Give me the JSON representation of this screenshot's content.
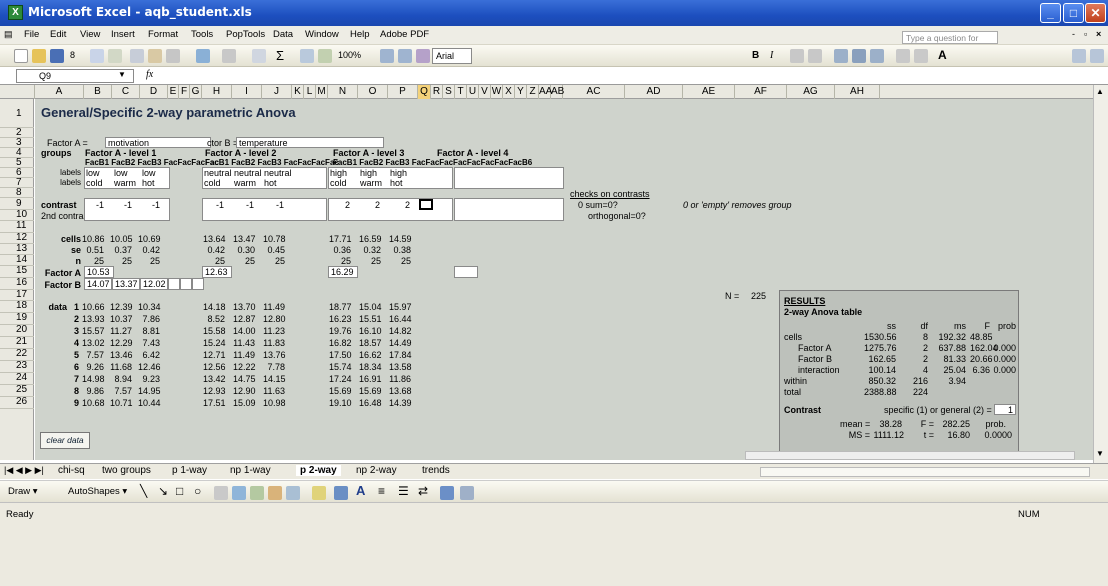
{
  "window": {
    "title": "Microsoft Excel - aqb_student.xls",
    "minimize": "_",
    "maximize": "□",
    "close": "✕"
  },
  "menu": [
    "File",
    "Edit",
    "View",
    "Insert",
    "Format",
    "Tools",
    "PopTools",
    "Data",
    "Window",
    "Help",
    "Adobe PDF"
  ],
  "help_placeholder": "Type a question for help",
  "toolbar": {
    "font_size": "8",
    "zoom": "100%",
    "font": "Arial",
    "bold": "B",
    "italic": "I"
  },
  "formula": {
    "namebox": "Q9",
    "fx": "fx"
  },
  "columns": [
    "A",
    "B",
    "C",
    "D",
    "E",
    "F",
    "G",
    "H",
    "I",
    "J",
    "K",
    "L",
    "M",
    "N",
    "O",
    "P",
    "Q",
    "R",
    "S",
    "T",
    "U",
    "V",
    "W",
    "X",
    "Y",
    "Z",
    "AA",
    "AB",
    "AC",
    "AD",
    "AE",
    "AF",
    "AG",
    "AH"
  ],
  "rows": [
    "1",
    "2",
    "3",
    "4",
    "5",
    "6",
    "7",
    "8",
    "9",
    "10",
    "11",
    "12",
    "13",
    "14",
    "15",
    "16",
    "17",
    "18",
    "19",
    "20",
    "21",
    "22",
    "23",
    "24",
    "25",
    "26"
  ],
  "sheet": {
    "title": "General/Specific 2-way parametric Anova",
    "factor_a_label": "Factor A =",
    "factor_a_value": "motivation",
    "factor_b_label": "ctor B =",
    "factor_b_value": "temperature",
    "groups": "groups",
    "levels": [
      "Factor A - level 1",
      "Factor A - level 2",
      "Factor A - level 3",
      "Factor A - level 4"
    ],
    "facb": "FacB1  FacB2  FacB3  FacFacFacFac",
    "facb_last": "FacB1  FacB2  FacB3  FacFacFacFacFacFacFacFacB6",
    "labels": "labels",
    "lab1": [
      [
        "low",
        "low",
        "low"
      ],
      [
        "neutral",
        "neutral",
        "neutral"
      ],
      [
        "high",
        "high",
        "high"
      ]
    ],
    "lab2": [
      [
        "cold",
        "warm",
        "hot"
      ],
      [
        "cold",
        "warm",
        "hot"
      ],
      [
        "cold",
        "warm",
        "hot"
      ]
    ],
    "checks_title": "checks on contrasts",
    "sum0": "0  sum=0?",
    "orth": "orthogonal=0?",
    "empty_note": "0 or 'empty' removes group",
    "contrast": "contrast",
    "contrast2": "2nd contrast",
    "contrast_vals": [
      [
        "-1",
        "-1",
        "-1"
      ],
      [
        "-1",
        "-1",
        "-1"
      ],
      [
        "2",
        "2",
        "2"
      ]
    ],
    "cells_lbl": "cells",
    "se_lbl": "se",
    "n_lbl": "n",
    "cells": [
      [
        "10.86",
        "10.05",
        "10.69"
      ],
      [
        "13.64",
        "13.47",
        "10.78"
      ],
      [
        "17.71",
        "16.59",
        "14.59"
      ]
    ],
    "se": [
      [
        "0.51",
        "0.37",
        "0.42"
      ],
      [
        "0.42",
        "0.30",
        "0.45"
      ],
      [
        "0.36",
        "0.32",
        "0.38"
      ]
    ],
    "n": [
      [
        "25",
        "25",
        "25"
      ],
      [
        "25",
        "25",
        "25"
      ],
      [
        "25",
        "25",
        "25"
      ]
    ],
    "factor_a": "Factor A",
    "factor_b": "Factor B",
    "fa_vals": [
      "10.53",
      "12.63",
      "16.29"
    ],
    "fb_vals": [
      "14.07",
      "13.37",
      "12.02"
    ],
    "n_total_lbl": "N =",
    "n_total": "225",
    "data_lbl": "data",
    "data_idx": [
      "1",
      "2",
      "3",
      "4",
      "5",
      "6",
      "7",
      "8",
      "9"
    ],
    "data": [
      [
        "10.66",
        "12.39",
        "10.34",
        "14.18",
        "13.70",
        "11.49",
        "18.77",
        "15.04",
        "15.97"
      ],
      [
        "13.93",
        "10.37",
        "7.86",
        "8.52",
        "12.87",
        "12.80",
        "16.23",
        "15.51",
        "16.44"
      ],
      [
        "15.57",
        "11.27",
        "8.81",
        "15.58",
        "14.00",
        "11.23",
        "19.76",
        "16.10",
        "14.82"
      ],
      [
        "13.02",
        "12.29",
        "7.43",
        "15.24",
        "11.43",
        "11.83",
        "16.82",
        "18.57",
        "14.49"
      ],
      [
        "7.57",
        "13.46",
        "6.42",
        "12.71",
        "11.49",
        "13.76",
        "17.50",
        "16.62",
        "17.84"
      ],
      [
        "9.26",
        "11.68",
        "12.46",
        "12.56",
        "12.22",
        "7.78",
        "15.74",
        "18.34",
        "13.58"
      ],
      [
        "14.98",
        "8.94",
        "9.23",
        "13.42",
        "14.75",
        "14.15",
        "17.24",
        "16.91",
        "11.86"
      ],
      [
        "9.86",
        "7.57",
        "14.95",
        "12.93",
        "12.90",
        "11.63",
        "15.69",
        "15.69",
        "13.68"
      ],
      [
        "10.68",
        "10.71",
        "10.44",
        "17.51",
        "15.09",
        "10.98",
        "19.10",
        "16.48",
        "14.39"
      ]
    ],
    "clear_data": "clear data"
  },
  "results": {
    "title": "RESULTS",
    "subtitle": "2-way Anova table",
    "headers": [
      "ss",
      "df",
      "ms",
      "F",
      "prob"
    ],
    "rows": [
      [
        "cells",
        "1530.56",
        "8",
        "192.32",
        "48.85",
        ""
      ],
      [
        "Factor A",
        "1275.76",
        "2",
        "637.88",
        "162.04",
        "0.000"
      ],
      [
        "Factor B",
        "162.65",
        "2",
        "81.33",
        "20.66",
        "0.000"
      ],
      [
        "interaction",
        "100.14",
        "4",
        "25.04",
        "6.36",
        "0.000"
      ],
      [
        "within",
        "850.32",
        "216",
        "3.94",
        "",
        ""
      ],
      [
        "total",
        "2388.88",
        "224",
        "",
        "",
        ""
      ]
    ],
    "contrast_lbl": "Contrast",
    "spec_lbl": "specific (1) or general (2) =",
    "spec_val": "1",
    "mean_lbl": "mean =",
    "mean_val": "38.28",
    "f_lbl": "F =",
    "f_val": "282.25",
    "prob_lbl": "prob.",
    "ms_lbl": "MS =",
    "ms_val": "1111.12",
    "t_lbl": "t =",
    "t_val": "16.80",
    "p_val": "0.0000"
  },
  "tabs": [
    "chi-sq",
    "two groups",
    "p 1-way",
    "np 1-way",
    "p 2-way",
    "np 2-way",
    "trends"
  ],
  "active_tab": "p 2-way",
  "draw": {
    "draw": "Draw ▾",
    "autoshapes": "AutoShapes ▾"
  },
  "status": {
    "ready": "Ready",
    "num": "NUM"
  }
}
